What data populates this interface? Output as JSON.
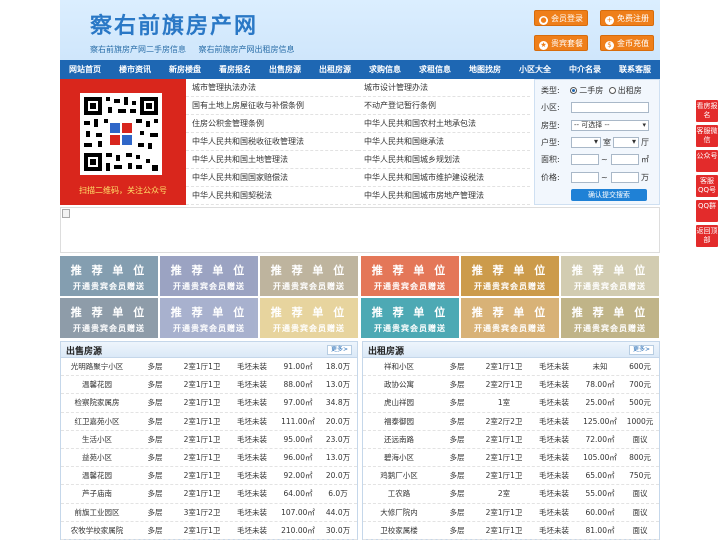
{
  "header": {
    "site_title": "察右前旗房产网",
    "sub_links": [
      "察右前旗房产网二手房信息",
      "察右前旗房产网出租房信息"
    ],
    "buttons": [
      {
        "label": "会员登录",
        "icon": "user-icon"
      },
      {
        "label": "免费注册",
        "icon": "register-icon"
      },
      {
        "label": "贵宾套餐",
        "icon": "vip-icon"
      },
      {
        "label": "金币充值",
        "icon": "coin-icon"
      }
    ]
  },
  "nav": [
    "网站首页",
    "楼市资讯",
    "新房楼盘",
    "看房报名",
    "出售房源",
    "出租房源",
    "求购信息",
    "求租信息",
    "地图找房",
    "小区大全",
    "中介名录",
    "联系客服"
  ],
  "qr": {
    "caption": "扫描二维码，关注公众号"
  },
  "links_left": [
    "城市管理执法办法",
    "国有土地上房屋征收与补偿条例",
    "住房公积金管理条例",
    "中华人民共和国税收征收管理法",
    "中华人民共和国土地管理法",
    "中华人民共和国国家赔偿法",
    "中华人民共和国契税法"
  ],
  "links_right": [
    "城市设计管理办法",
    "不动产登记暂行条例",
    "中华人民共和国农村土地承包法",
    "中华人民共和国继承法",
    "中华人民共和国城乡规划法",
    "中华人民共和国城市维护建设税法",
    "中华人民共和国城市房地产管理法"
  ],
  "search": {
    "type_label": "类型:",
    "type_options": [
      "二手房",
      "出租房"
    ],
    "community_label": "小区:",
    "room_type_label": "房型:",
    "room_type_value": "-- 可选择 --",
    "layout_label": "户型:",
    "room_unit": "室",
    "hall_unit": "厅",
    "area_label": "面积:",
    "area_unit": "㎡",
    "price_label": "价格:",
    "price_unit": "万",
    "range_sep": "~",
    "submit": "确认提交搜索"
  },
  "ad_tiles": {
    "line1": "推 荐 单 位",
    "line2": "开通贵宾会员赠送",
    "colors": [
      "#6f8ea3",
      "#8a94b8",
      "#b3a88e",
      "#e0603c",
      "#c48a2c",
      "#cbc4a4",
      "#7b8b9b",
      "#9aa4c6",
      "#e3cd8e",
      "#2f9ba8",
      "#d2a560",
      "#b6a774"
    ]
  },
  "sale": {
    "title": "出售房源",
    "more": "更多>",
    "rows": [
      [
        "光明路聚宁小区",
        "多层",
        "2室1厅1卫",
        "毛坯未装",
        "91.00㎡",
        "18.0万"
      ],
      [
        "温馨花园",
        "多层",
        "2室1厅1卫",
        "毛坯未装",
        "88.00㎡",
        "13.0万"
      ],
      [
        "检察院家属房",
        "多层",
        "2室1厅1卫",
        "毛坯未装",
        "97.00㎡",
        "34.8万"
      ],
      [
        "红卫嘉苑小区",
        "多层",
        "2室1厅1卫",
        "毛坯未装",
        "111.00㎡",
        "20.0万"
      ],
      [
        "生活小区",
        "多层",
        "2室1厅1卫",
        "毛坯未装",
        "95.00㎡",
        "23.0万"
      ],
      [
        "益苑小区",
        "多层",
        "2室1厅1卫",
        "毛坯未装",
        "96.00㎡",
        "13.0万"
      ],
      [
        "温馨花园",
        "多层",
        "2室1厅1卫",
        "毛坯未装",
        "92.00㎡",
        "20.0万"
      ],
      [
        "芦子庙南",
        "多层",
        "2室1厅1卫",
        "毛坯未装",
        "64.00㎡",
        "6.0万"
      ],
      [
        "前旗工业园区",
        "多层",
        "3室1厅2卫",
        "毛坯未装",
        "107.00㎡",
        "44.0万"
      ],
      [
        "农牧学校家属院",
        "多层",
        "2室1厅1卫",
        "毛坯未装",
        "210.00㎡",
        "30.0万"
      ]
    ]
  },
  "rent": {
    "title": "出租房源",
    "more": "更多>",
    "rows": [
      [
        "祥和小区",
        "多层",
        "2室1厅1卫",
        "毛坯未装",
        "未知",
        "600元"
      ],
      [
        "政协公寓",
        "多层",
        "2室2厅1卫",
        "毛坯未装",
        "78.00㎡",
        "700元"
      ],
      [
        "虎山祥园",
        "多层",
        "1室",
        "毛坯未装",
        "25.00㎡",
        "500元"
      ],
      [
        "福泰御园",
        "多层",
        "2室2厅2卫",
        "毛坯未装",
        "125.00㎡",
        "1000元"
      ],
      [
        "还远南路",
        "多层",
        "2室1厅1卫",
        "毛坯未装",
        "72.00㎡",
        "面议"
      ],
      [
        "碧海小区",
        "多层",
        "2室1厅1卫",
        "毛坯未装",
        "105.00㎡",
        "800元"
      ],
      [
        "鸡鹅厂小区",
        "多层",
        "2室1厅1卫",
        "毛坯未装",
        "65.00㎡",
        "750元"
      ],
      [
        "工农路",
        "多层",
        "2室",
        "毛坯未装",
        "55.00㎡",
        "面议"
      ],
      [
        "大修厂院内",
        "多层",
        "2室1厅1卫",
        "毛坯未装",
        "60.00㎡",
        "面议"
      ],
      [
        "卫校家属楼",
        "多层",
        "2室1厅1卫",
        "毛坯未装",
        "81.00㎡",
        "面议"
      ]
    ]
  },
  "side": [
    "看房报名",
    "客服微信",
    "公众号",
    "客服QQ号",
    "QQ群",
    "返回顶部"
  ]
}
